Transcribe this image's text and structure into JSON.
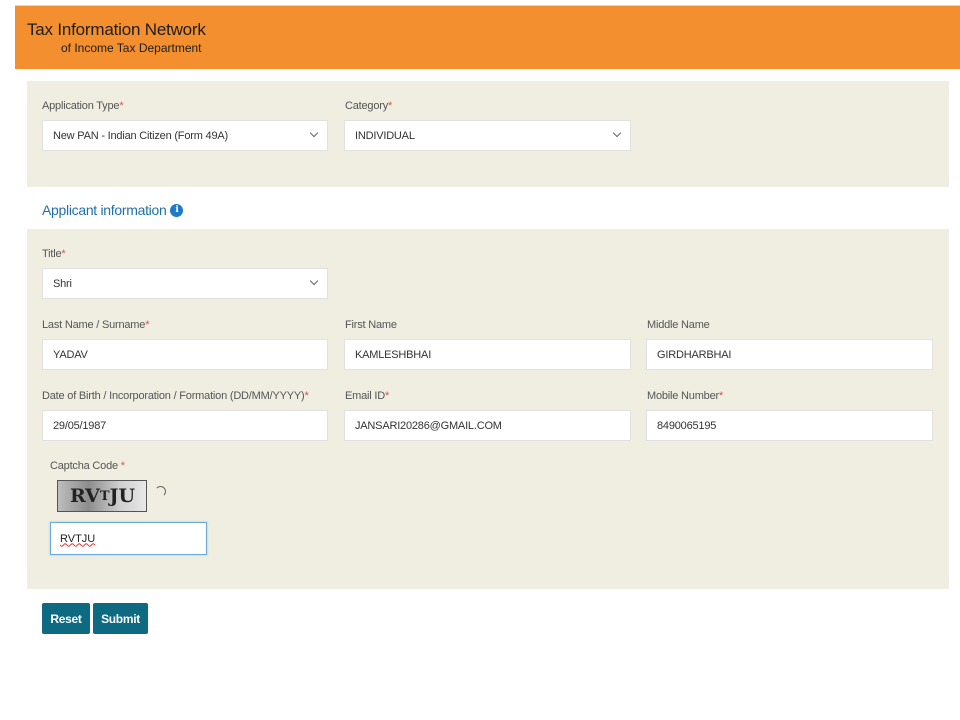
{
  "header": {
    "title": "Tax Information Network",
    "subtitle": "of Income Tax Department",
    "bg_color": "#f38f2f"
  },
  "application": {
    "type_label": "Application Type",
    "type_value": "New PAN - Indian Citizen (Form 49A)",
    "category_label": "Category",
    "category_value": "INDIVIDUAL"
  },
  "applicant": {
    "section_title": "Applicant information",
    "title_label": "Title",
    "title_value": "Shri",
    "last_name_label": "Last Name / Surname",
    "last_name_value": "YADAV",
    "first_name_label": "First Name",
    "first_name_value": "KAMLESHBHAI",
    "middle_name_label": "Middle Name",
    "middle_name_value": "GIRDHARBHAI",
    "dob_label": "Date of Birth / Incorporation / Formation (DD/MM/YYYY)",
    "dob_value": "29/05/1987",
    "email_label": "Email ID",
    "email_value": "JANSARI20286@GMAIL.COM",
    "mobile_label": "Mobile Number",
    "mobile_value": "8490065195"
  },
  "captcha": {
    "label": "Captcha Code",
    "image_text_big": "RV",
    "image_text_small": "T",
    "image_text_end": "JU",
    "input_value": "RVTJU"
  },
  "actions": {
    "reset_label": "Reset",
    "submit_label": "Submit"
  },
  "required_mark": "*",
  "info_icon_glyph": "i"
}
